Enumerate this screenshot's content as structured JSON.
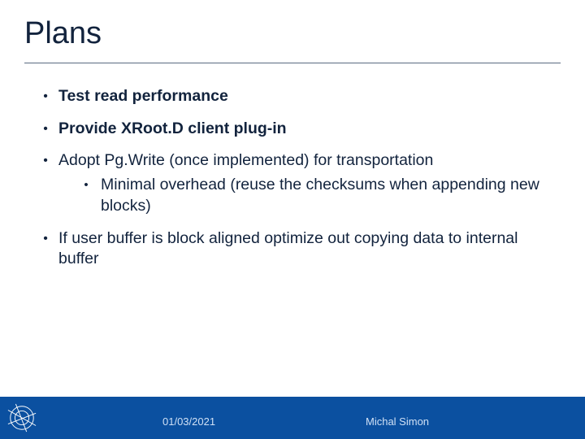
{
  "title": "Plans",
  "bullets": {
    "b0": "Test read performance",
    "b1": "Provide XRoot.D client plug-in",
    "b2": "Adopt Pg.Write (once implemented) for transportation",
    "b2_sub": "Minimal overhead (reuse the checksums when appending new blocks)",
    "b3": "If user buffer is block aligned optimize out copying data to internal buffer"
  },
  "footer": {
    "date": "01/03/2021",
    "author": "Michal Simon"
  }
}
